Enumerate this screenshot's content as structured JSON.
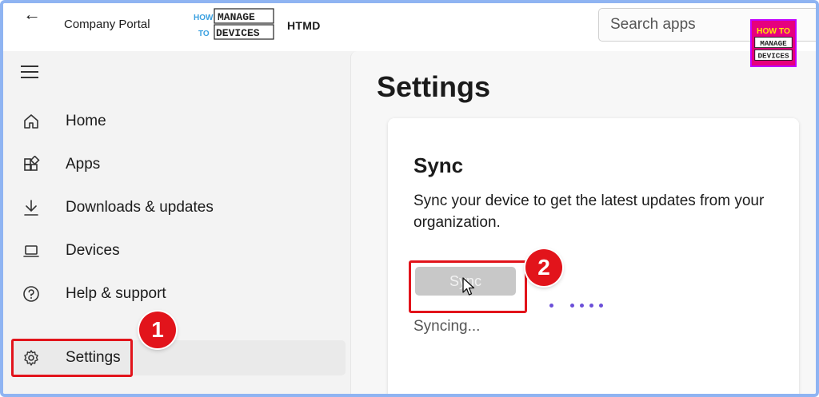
{
  "titlebar": {
    "back_label": "←",
    "app_title": "Company Portal",
    "logo_top_small": "HOW",
    "logo_top_big": "MANAGE",
    "logo_bottom_small": "TO",
    "logo_bottom_big": "DEVICES",
    "htmd": "HTMD",
    "search_placeholder": "Search apps"
  },
  "corner_logo": {
    "line1": "HOW TO",
    "line2": "MANAGE",
    "line3": "DEVICES"
  },
  "sidebar": {
    "items": [
      {
        "label": "Home",
        "icon": "home-icon"
      },
      {
        "label": "Apps",
        "icon": "apps-icon"
      },
      {
        "label": "Downloads & updates",
        "icon": "download-icon"
      },
      {
        "label": "Devices",
        "icon": "laptop-icon"
      },
      {
        "label": "Help & support",
        "icon": "help-icon"
      },
      {
        "label": "Settings",
        "icon": "gear-icon",
        "active": true
      }
    ]
  },
  "annotations": {
    "badge1": "1",
    "badge2": "2",
    "highlight_color": "#e2141b"
  },
  "main": {
    "title": "Settings",
    "card": {
      "title": "Sync",
      "description": "Sync your device to get the latest updates from your organization.",
      "button_label": "Sync",
      "status": "Syncing..."
    }
  },
  "colors": {
    "accent": "#6b4fd8",
    "logo_pink": "#e6007e",
    "frame": "#8fb4f2"
  }
}
